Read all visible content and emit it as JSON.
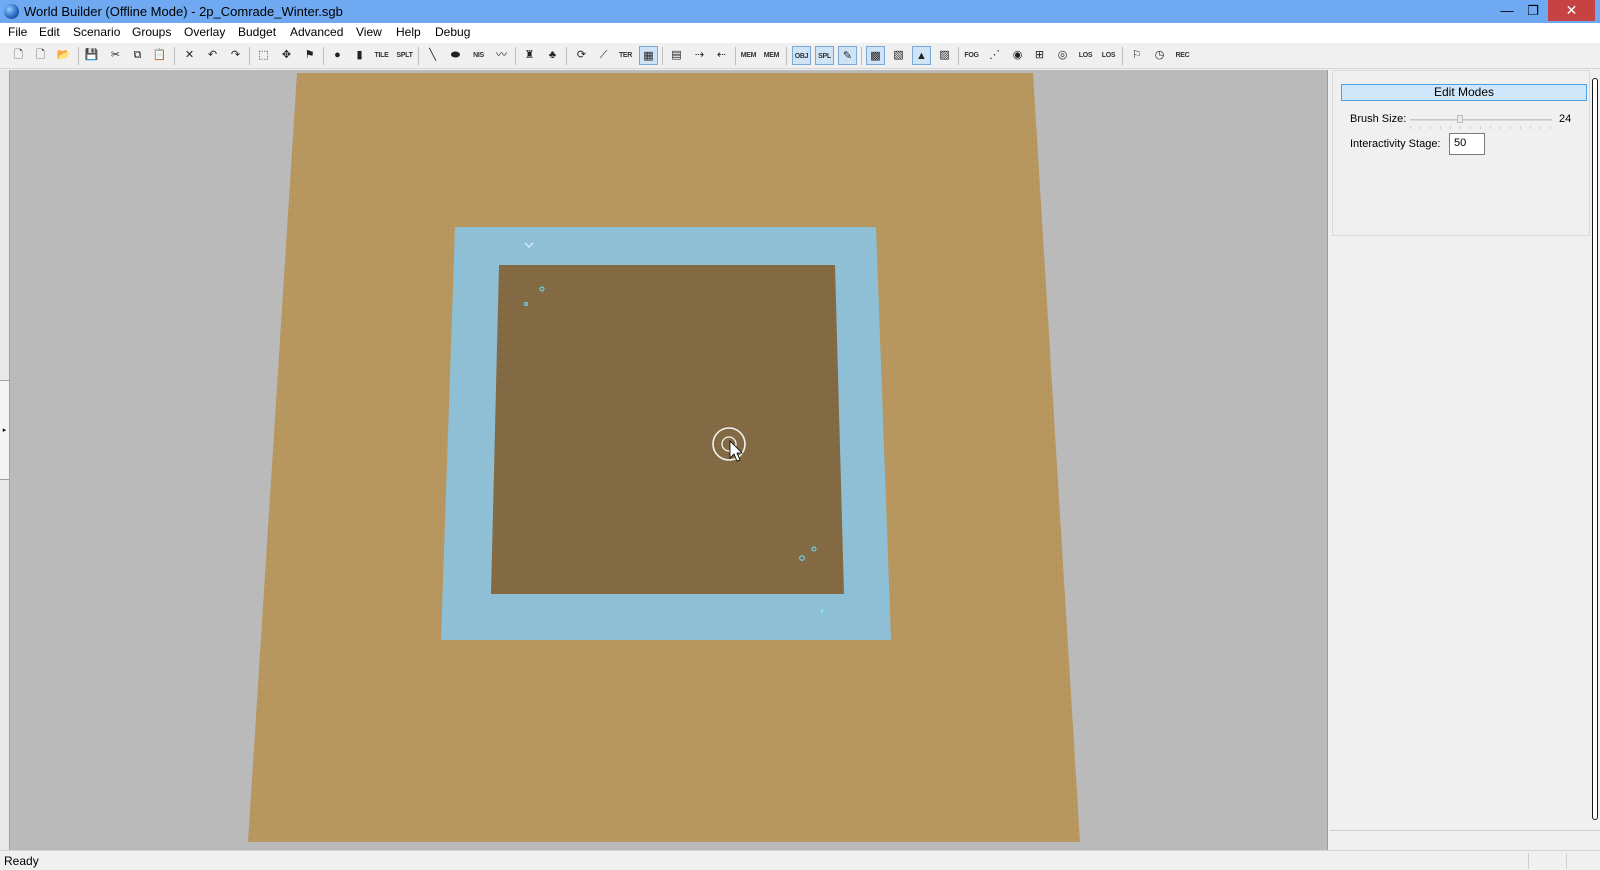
{
  "window": {
    "title": "World Builder (Offline Mode) - 2p_Comrade_Winter.sgb",
    "minimize_glyph": "—",
    "maximize_glyph": "❐",
    "close_glyph": "✕"
  },
  "menu": [
    "File",
    "Edit",
    "Scenario",
    "Groups",
    "Overlay",
    "Budget",
    "Advanced",
    "View",
    "Help",
    "Debug"
  ],
  "toolbar": {
    "labels": {
      "tile": "TILE",
      "splt": "SPLT",
      "nis": "NIS",
      "ter": "TER",
      "mem_dmp": "MEM DMP",
      "mem_stat": "MEM STAT",
      "obj": "OBJ",
      "spl": "SPL",
      "fog": "FOG",
      "los1": "LOS",
      "los2": "LOS",
      "rec": "REC"
    }
  },
  "panel": {
    "edit_modes_label": "Edit Modes",
    "brush_size_label": "Brush Size:",
    "brush_size_value": "24",
    "brush_size_fraction": 0.35,
    "interactivity_label": "Interactivity Stage:",
    "interactivity_value": "50"
  },
  "status": {
    "text": "Ready"
  },
  "colors": {
    "title_bar": "#6ea9f2",
    "outer_terrain": "#b8975e",
    "water": "#8fbfd5",
    "inner_terrain": "#836a43",
    "viewport_bg": "#bababa",
    "close_button": "#c74343"
  }
}
